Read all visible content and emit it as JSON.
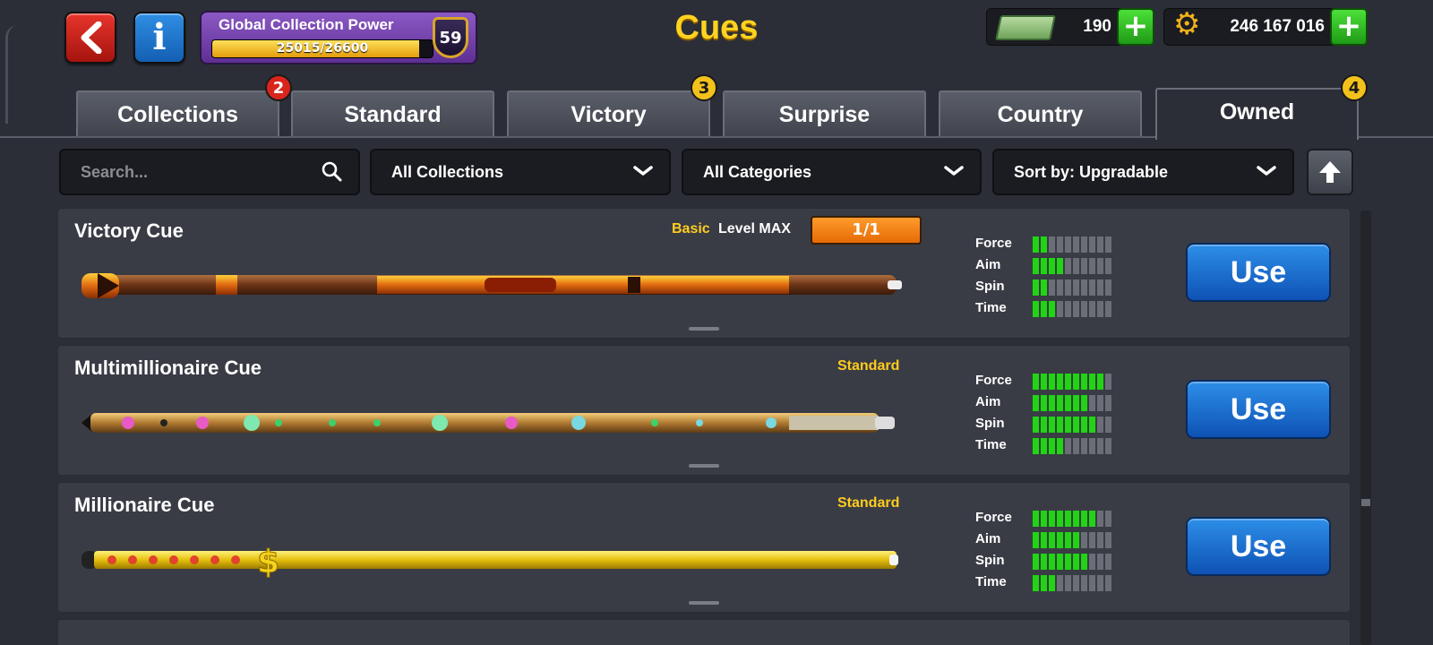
{
  "header": {
    "title": "Cues",
    "collection_power": {
      "label": "Global Collection Power",
      "progress_text": "25015/26600",
      "current": 25015,
      "max": 26600,
      "level": "59"
    },
    "cash": {
      "value": "190"
    },
    "coins": {
      "value": "246 167 016"
    },
    "plus_label": "+"
  },
  "tabs": [
    {
      "label": "Collections",
      "badge": "2",
      "badge_color": "red"
    },
    {
      "label": "Standard"
    },
    {
      "label": "Victory",
      "badge": "3",
      "badge_color": "yellow"
    },
    {
      "label": "Surprise"
    },
    {
      "label": "Country"
    },
    {
      "label": "Owned",
      "badge": "4",
      "badge_color": "yellow",
      "active": true
    }
  ],
  "filters": {
    "search_placeholder": "Search...",
    "collections": "All Collections",
    "categories": "All Categories",
    "sort": "Sort by: Upgradable"
  },
  "stat_labels": [
    "Force",
    "Aim",
    "Spin",
    "Time"
  ],
  "cues": [
    {
      "name": "Victory Cue",
      "tier": "Basic",
      "level_label": "Level MAX",
      "level_value": "1/1",
      "stats": {
        "force": 2,
        "aim": 4,
        "spin": 2,
        "time": 3
      },
      "use_label": "Use"
    },
    {
      "name": "Multimillionaire Cue",
      "tier": "Standard",
      "stats": {
        "force": 9,
        "aim": 7,
        "spin": 8,
        "time": 4
      },
      "use_label": "Use"
    },
    {
      "name": "Millionaire Cue",
      "tier": "Standard",
      "stats": {
        "force": 8,
        "aim": 6,
        "spin": 7,
        "time": 3
      },
      "use_label": "Use"
    }
  ],
  "colors": {
    "title": "#ffd21f",
    "tier": "#ffcc1f",
    "stat_on": "#21d414",
    "stat_off": "#6b6e76",
    "use_button": "#1a6fd0",
    "level_bar": "#f58518"
  },
  "icons": [
    "back-arrow-icon",
    "info-icon",
    "shield-icon",
    "cash-icon",
    "gear-coin-icon",
    "plus-icon",
    "search-icon",
    "chevron-down-icon",
    "arrow-up-icon"
  ]
}
